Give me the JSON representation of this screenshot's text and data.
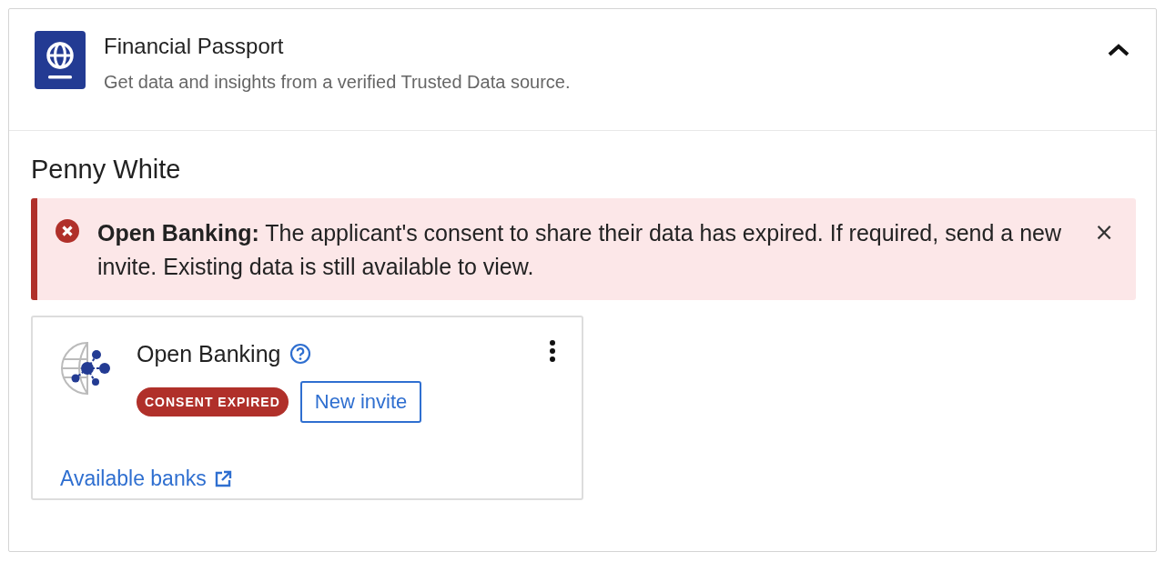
{
  "panel": {
    "title": "Financial Passport",
    "subtitle": "Get data and insights from a verified Trusted Data source.",
    "expanded": true
  },
  "applicant": {
    "name": "Penny White"
  },
  "alert": {
    "message": "**Open Banking:** The applicant's consent to share their data has expired. If required, send a new invite. Existing data is still available to view.",
    "close": "×"
  },
  "cards": [
    {
      "title": "Open Banking",
      "status": "CONSENT EXPIRED",
      "action": "New invite",
      "link": "Available banks"
    }
  ]
}
